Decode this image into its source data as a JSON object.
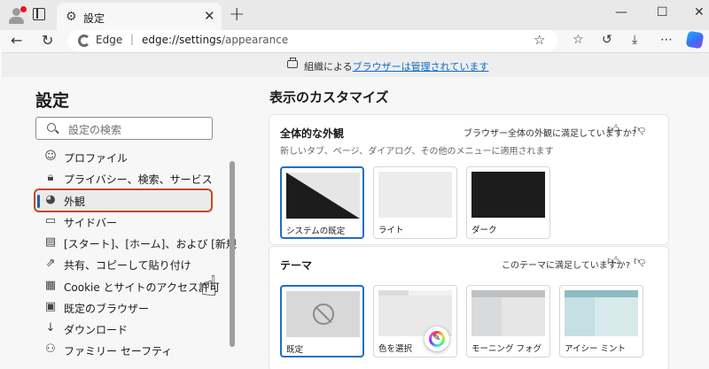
{
  "browser": {
    "tab_title": "設定",
    "brand_label": "Edge",
    "url_host": "edge://settings",
    "url_path": "/appearance"
  },
  "managed_bar": {
    "prefix": "組織による",
    "link": "ブラウザーは管理されています"
  },
  "sidebar": {
    "title": "設定",
    "search_placeholder": "設定の検索",
    "items": [
      {
        "label": "プロファイル",
        "icon": "profile-icon"
      },
      {
        "label": "プライバシー、検索、サービス",
        "icon": "lock-icon"
      },
      {
        "label": "外観",
        "icon": "palette-icon",
        "selected": true
      },
      {
        "label": "サイドバー",
        "icon": "sidebar-icon"
      },
      {
        "label": "[スタート]、[ホーム]、および [新規] タブ",
        "icon": "home-tabs-icon"
      },
      {
        "label": "共有、コピーして貼り付け",
        "icon": "share-icon"
      },
      {
        "label": "Cookie とサイトのアクセス許可",
        "icon": "cookie-icon"
      },
      {
        "label": "既定のブラウザー",
        "icon": "browser-icon"
      },
      {
        "label": "ダウンロード",
        "icon": "download-icon"
      },
      {
        "label": "ファミリー セーフティ",
        "icon": "family-icon"
      }
    ]
  },
  "main": {
    "heading": "表示のカスタマイズ",
    "overall": {
      "title": "全体的な外観",
      "subtitle": "新しいタブ、ページ、ダイアログ、その他のメニューに適用されます",
      "feedback": "ブラウザー全体の外観に満足していますか?",
      "options": [
        {
          "label": "システムの既定",
          "selected": true
        },
        {
          "label": "ライト"
        },
        {
          "label": "ダーク"
        }
      ]
    },
    "theme": {
      "title": "テーマ",
      "feedback": "このテーマに満足していますか?",
      "options": [
        {
          "label": "既定",
          "selected": true
        },
        {
          "label": "色を選択"
        },
        {
          "label": "モーニング フォグ"
        },
        {
          "label": "アイシー ミント"
        }
      ]
    }
  },
  "colors": {
    "accent": "#1f6fc6",
    "highlight_outline": "#c24a2c",
    "link": "#0f6cbd"
  }
}
